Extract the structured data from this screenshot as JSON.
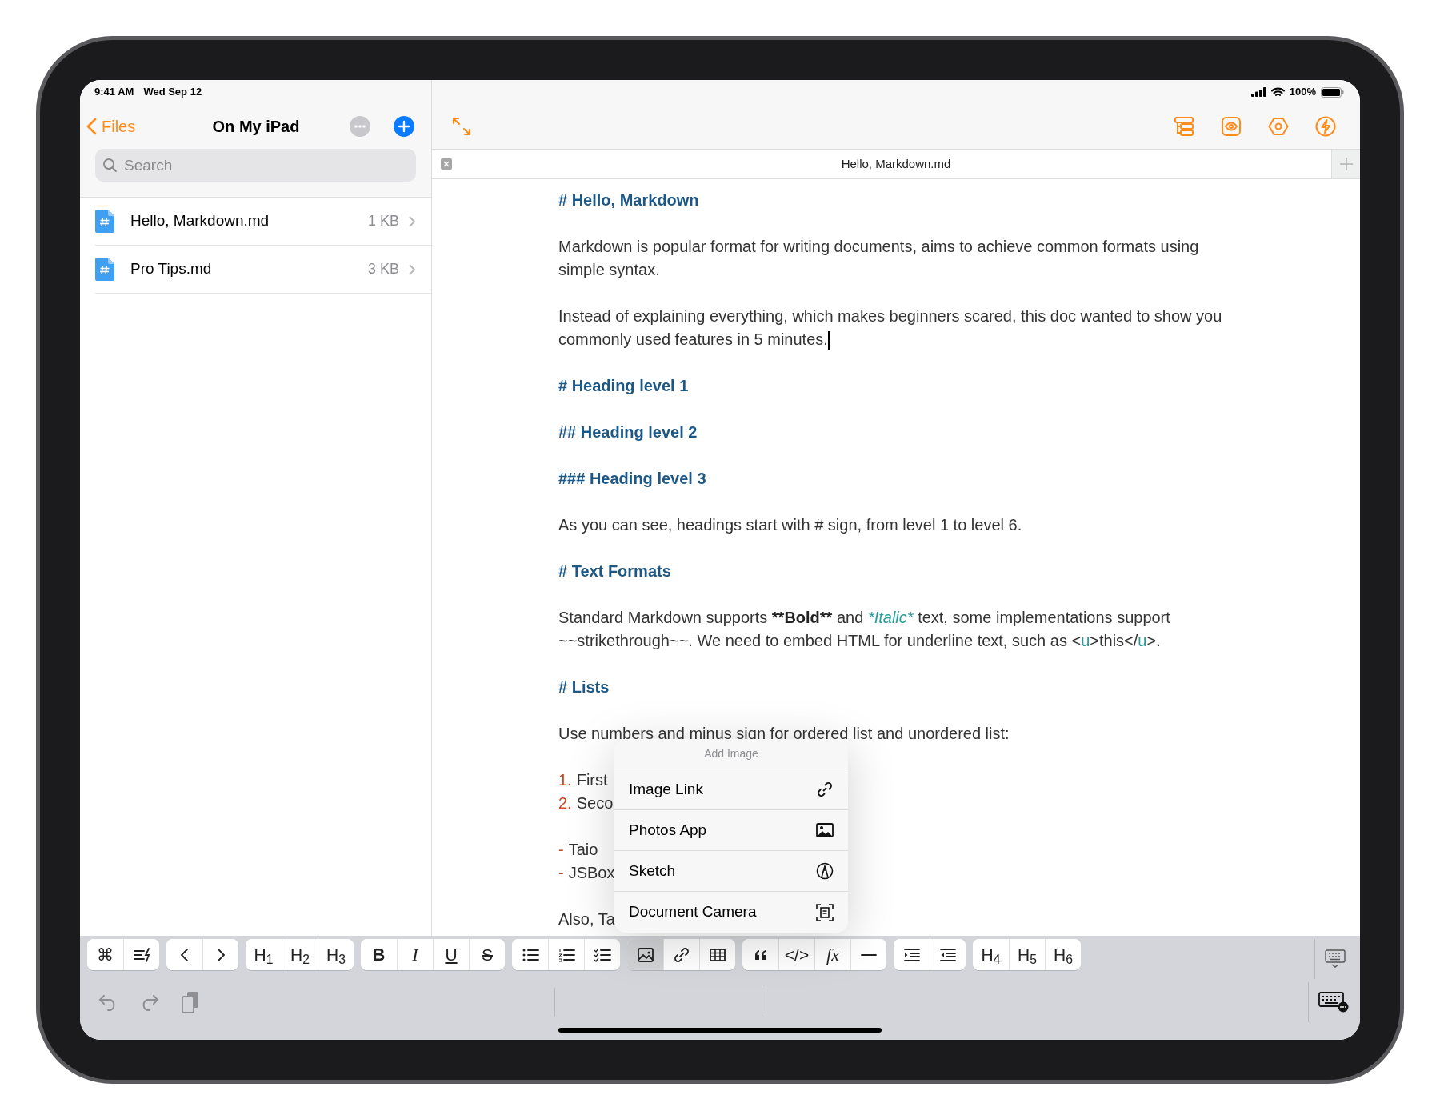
{
  "status_bar": {
    "time": "9:41 AM",
    "date": "Wed Sep 12",
    "battery": "100%"
  },
  "sidebar": {
    "back": "Files",
    "title": "On My iPad",
    "search": {
      "placeholder": "Search"
    },
    "files": [
      {
        "name": "Hello, Markdown.md",
        "size": "1 KB"
      },
      {
        "name": "Pro Tips.md",
        "size": "3 KB"
      }
    ]
  },
  "editor": {
    "tab_title": "Hello, Markdown.md",
    "blocks": [
      {
        "kind": "heading",
        "text": "# Hello, Markdown"
      },
      {
        "kind": "paragraph",
        "segments": [
          {
            "kind": "plain",
            "text": "Markdown is popular format for writing documents, aims to achieve common formats using simple syntax."
          }
        ]
      },
      {
        "kind": "paragraph",
        "caret": true,
        "segments": [
          {
            "kind": "plain",
            "text": "Instead of explaining everything, which makes beginners scared, this doc wanted to show you commonly used features in 5 minutes."
          }
        ]
      },
      {
        "kind": "heading",
        "text": "# Heading level 1"
      },
      {
        "kind": "heading",
        "text": "## Heading level 2"
      },
      {
        "kind": "heading",
        "text": "### Heading level 3"
      },
      {
        "kind": "paragraph",
        "segments": [
          {
            "kind": "plain",
            "text": "As you can see, headings start with # sign, from level 1 to level 6."
          }
        ]
      },
      {
        "kind": "heading",
        "text": "# Text Formats"
      },
      {
        "kind": "paragraph",
        "segments": [
          {
            "kind": "plain",
            "text": "Standard Markdown supports "
          },
          {
            "kind": "bold",
            "text": "**Bold**"
          },
          {
            "kind": "plain",
            "text": " and "
          },
          {
            "kind": "italic",
            "text": "*Italic*"
          },
          {
            "kind": "plain",
            "text": " text, some implementations support ~~strikethrough~~. We need to embed HTML for underline text, such as <"
          },
          {
            "kind": "tag",
            "text": "u"
          },
          {
            "kind": "plain",
            "text": ">this</"
          },
          {
            "kind": "tag",
            "text": "u"
          },
          {
            "kind": "plain",
            "text": ">."
          }
        ]
      },
      {
        "kind": "heading",
        "text": "# Lists"
      },
      {
        "kind": "paragraph",
        "segments": [
          {
            "kind": "plain",
            "text": "Use numbers and minus sign for ordered list and unordered list:"
          }
        ]
      },
      {
        "kind": "list",
        "items": [
          {
            "marker": "1.",
            "text": "First"
          },
          {
            "marker": "2.",
            "text": "Seco"
          }
        ]
      },
      {
        "kind": "list",
        "items": [
          {
            "marker": "-",
            "text": "Taio"
          },
          {
            "marker": "-",
            "text": "JSBox"
          }
        ]
      },
      {
        "kind": "paragraph",
        "segments": [
          {
            "kind": "plain",
            "text": "Also, Ta"
          }
        ]
      }
    ]
  },
  "popup": {
    "title": "Add Image",
    "items": [
      {
        "label": "Image Link"
      },
      {
        "label": "Photos App"
      },
      {
        "label": "Sketch"
      },
      {
        "label": "Document Camera"
      }
    ]
  },
  "toolbar": {
    "groups": [
      [
        {
          "kind": "text",
          "label": "⌘",
          "selected": false
        },
        {
          "kind": "icon",
          "selected": false
        }
      ],
      [
        {
          "kind": "icon",
          "selected": false
        },
        {
          "kind": "icon",
          "selected": false
        }
      ],
      [
        {
          "kind": "text",
          "label": "H$_{1}$",
          "selected": false
        },
        {
          "kind": "text",
          "label": "H$_{2}$",
          "selected": false
        },
        {
          "kind": "text",
          "label": "H$_{3}$",
          "selected": false
        }
      ],
      [
        {
          "kind": "bold",
          "label": "B",
          "selected": false
        },
        {
          "kind": "italic",
          "label": "I",
          "selected": false
        },
        {
          "kind": "underline",
          "label": "U",
          "selected": false
        },
        {
          "kind": "strike",
          "label": "S",
          "selected": false
        }
      ],
      [
        {
          "kind": "icon",
          "selected": false
        },
        {
          "kind": "icon",
          "selected": false
        },
        {
          "kind": "icon",
          "selected": false
        }
      ],
      [
        {
          "kind": "icon",
          "selected": true
        },
        {
          "kind": "icon",
          "selected": false
        },
        {
          "kind": "icon",
          "selected": false
        }
      ],
      [
        {
          "kind": "icon",
          "selected": false
        },
        {
          "kind": "text",
          "label": "</>",
          "selected": false
        },
        {
          "kind": "italic",
          "label": "fx",
          "selected": false
        },
        {
          "kind": "icon",
          "selected": false
        }
      ],
      [
        {
          "kind": "icon",
          "selected": false
        },
        {
          "kind": "icon",
          "selected": false
        }
      ],
      [
        {
          "kind": "text",
          "label": "H$_{4}$",
          "selected": false
        },
        {
          "kind": "text",
          "label": "H$_{5}$",
          "selected": false
        },
        {
          "kind": "text",
          "label": "H$_{6}$",
          "selected": false
        }
      ]
    ]
  }
}
